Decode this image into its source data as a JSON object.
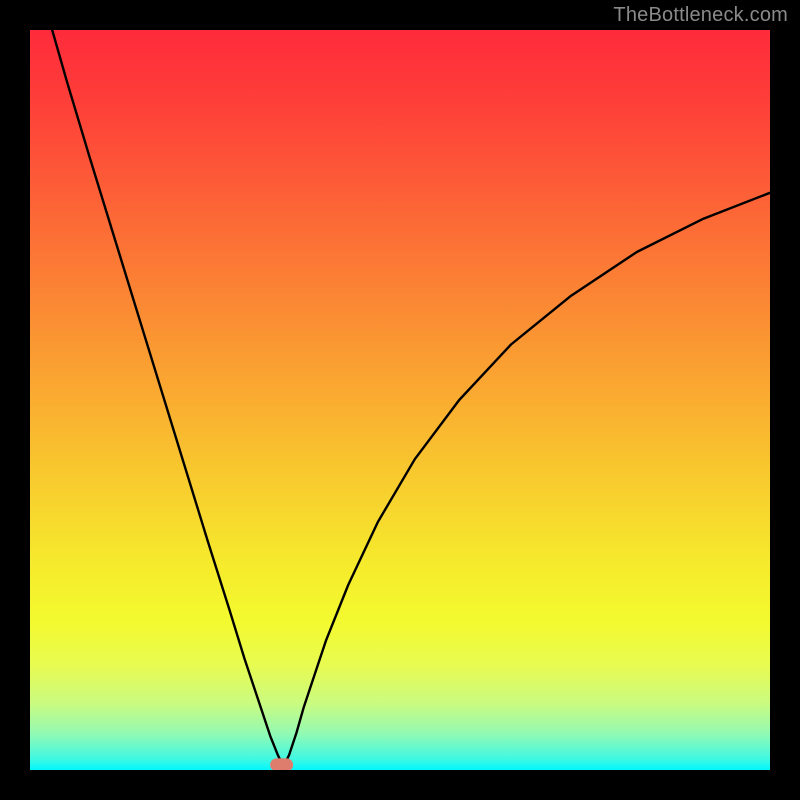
{
  "watermark": "TheBottleneck.com",
  "marker_color": "#de7d6d",
  "chart_data": {
    "type": "line",
    "title": "",
    "xlabel": "",
    "ylabel": "",
    "xlim": [
      0,
      100
    ],
    "ylim": [
      0,
      100
    ],
    "x": [
      3,
      5,
      8,
      12,
      16,
      20,
      24,
      27,
      29,
      31,
      32.5,
      33.5,
      34,
      34.5,
      35,
      36,
      37,
      38.5,
      40,
      43,
      47,
      52,
      58,
      65,
      73,
      82,
      91,
      100
    ],
    "values": [
      100,
      93,
      83,
      70,
      57,
      44,
      31,
      21.5,
      15,
      9,
      4.5,
      2,
      1,
      1,
      2,
      5,
      8.5,
      13,
      17.5,
      25,
      33.5,
      42,
      50,
      57.5,
      64,
      70,
      74.5,
      78
    ],
    "series": [
      {
        "name": "bottleneck-curve",
        "x_key": "x",
        "y_key": "values"
      }
    ],
    "marker": {
      "x": 34,
      "y": 0.7
    },
    "gradient_stops": [
      {
        "offset": 0.0,
        "color": "#fe2b3a"
      },
      {
        "offset": 0.1,
        "color": "#fe3f39"
      },
      {
        "offset": 0.22,
        "color": "#fd5f37"
      },
      {
        "offset": 0.35,
        "color": "#fb8334"
      },
      {
        "offset": 0.48,
        "color": "#faa731"
      },
      {
        "offset": 0.6,
        "color": "#f8c92e"
      },
      {
        "offset": 0.72,
        "color": "#f6ea2c"
      },
      {
        "offset": 0.8,
        "color": "#f3fa2f"
      },
      {
        "offset": 0.86,
        "color": "#e7fb52"
      },
      {
        "offset": 0.91,
        "color": "#cafb80"
      },
      {
        "offset": 0.95,
        "color": "#94fab2"
      },
      {
        "offset": 0.985,
        "color": "#40f8e2"
      },
      {
        "offset": 1.0,
        "color": "#02f7fd"
      }
    ]
  }
}
